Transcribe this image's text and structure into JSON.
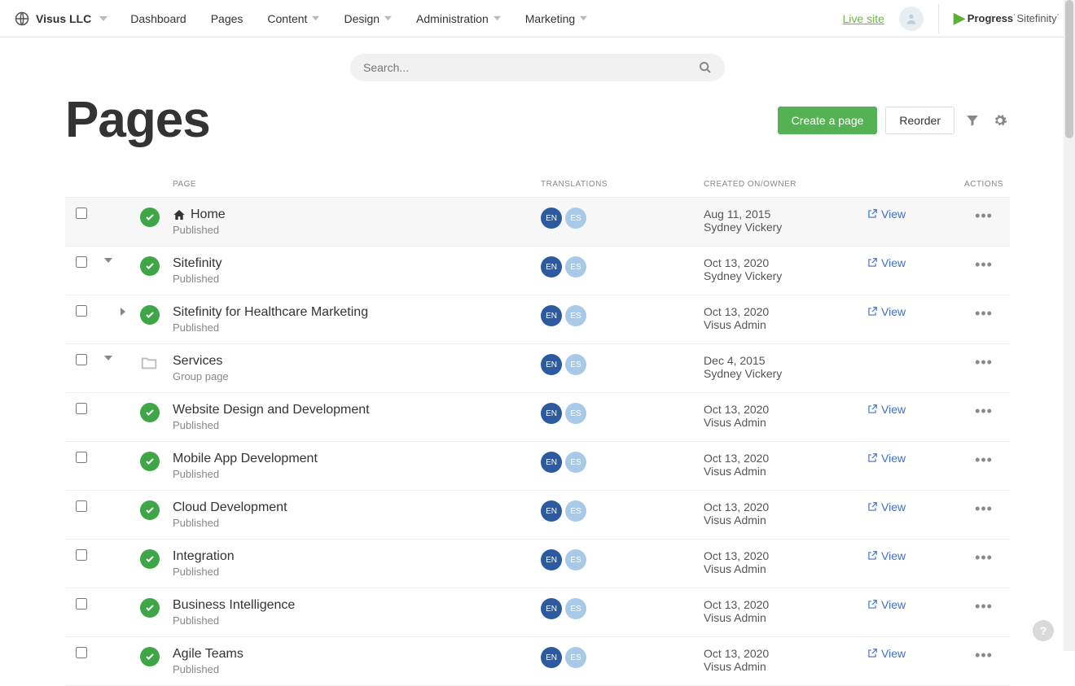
{
  "brand": "Visus LLC",
  "nav": [
    {
      "label": "Dashboard",
      "dd": false
    },
    {
      "label": "Pages",
      "dd": false
    },
    {
      "label": "Content",
      "dd": true
    },
    {
      "label": "Design",
      "dd": true
    },
    {
      "label": "Administration",
      "dd": true
    },
    {
      "label": "Marketing",
      "dd": true
    }
  ],
  "live_site": "Live site",
  "logo": {
    "brand": "Progress",
    "product": "Sitefinity"
  },
  "search": {
    "placeholder": "Search..."
  },
  "page_title": "Pages",
  "buttons": {
    "create": "Create a page",
    "reorder": "Reorder"
  },
  "columns": {
    "page": "PAGE",
    "translations": "TRANSLATIONS",
    "created": "CREATED ON/OWNER",
    "actions": "ACTIONS"
  },
  "view_label": "View",
  "langs": [
    "EN",
    "ES"
  ],
  "rows": [
    {
      "indent": 0,
      "expand": "",
      "icon": "check",
      "home": true,
      "title": "Home",
      "sub": "Published",
      "date": "Aug 11, 2015",
      "owner": "Sydney Vickery",
      "view": true,
      "selected": true
    },
    {
      "indent": 0,
      "expand": "down",
      "icon": "check",
      "home": false,
      "title": "Sitefinity",
      "sub": "Published",
      "date": "Oct 13, 2020",
      "owner": "Sydney Vickery",
      "view": true
    },
    {
      "indent": 1,
      "expand": "right",
      "icon": "check",
      "home": false,
      "title": "Sitefinity for Healthcare Marketing",
      "sub": "Published",
      "date": "Oct 13, 2020",
      "owner": "Visus Admin",
      "view": true
    },
    {
      "indent": 0,
      "expand": "down",
      "icon": "folder",
      "home": false,
      "title": "Services",
      "sub": "Group page",
      "date": "Dec 4, 2015",
      "owner": "Sydney Vickery",
      "view": false
    },
    {
      "indent": 1,
      "expand": "",
      "icon": "check",
      "home": false,
      "title": "Website Design and Development",
      "sub": "Published",
      "date": "Oct 13, 2020",
      "owner": "Visus Admin",
      "view": true
    },
    {
      "indent": 1,
      "expand": "",
      "icon": "check",
      "home": false,
      "title": "Mobile App Development",
      "sub": "Published",
      "date": "Oct 13, 2020",
      "owner": "Visus Admin",
      "view": true
    },
    {
      "indent": 1,
      "expand": "",
      "icon": "check",
      "home": false,
      "title": "Cloud Development",
      "sub": "Published",
      "date": "Oct 13, 2020",
      "owner": "Visus Admin",
      "view": true
    },
    {
      "indent": 1,
      "expand": "",
      "icon": "check",
      "home": false,
      "title": "Integration",
      "sub": "Published",
      "date": "Oct 13, 2020",
      "owner": "Visus Admin",
      "view": true
    },
    {
      "indent": 1,
      "expand": "",
      "icon": "check",
      "home": false,
      "title": "Business Intelligence",
      "sub": "Published",
      "date": "Oct 13, 2020",
      "owner": "Visus Admin",
      "view": true
    },
    {
      "indent": 1,
      "expand": "",
      "icon": "check",
      "home": false,
      "title": "Agile Teams",
      "sub": "Published",
      "date": "Oct 13, 2020",
      "owner": "Visus Admin",
      "view": true
    }
  ]
}
